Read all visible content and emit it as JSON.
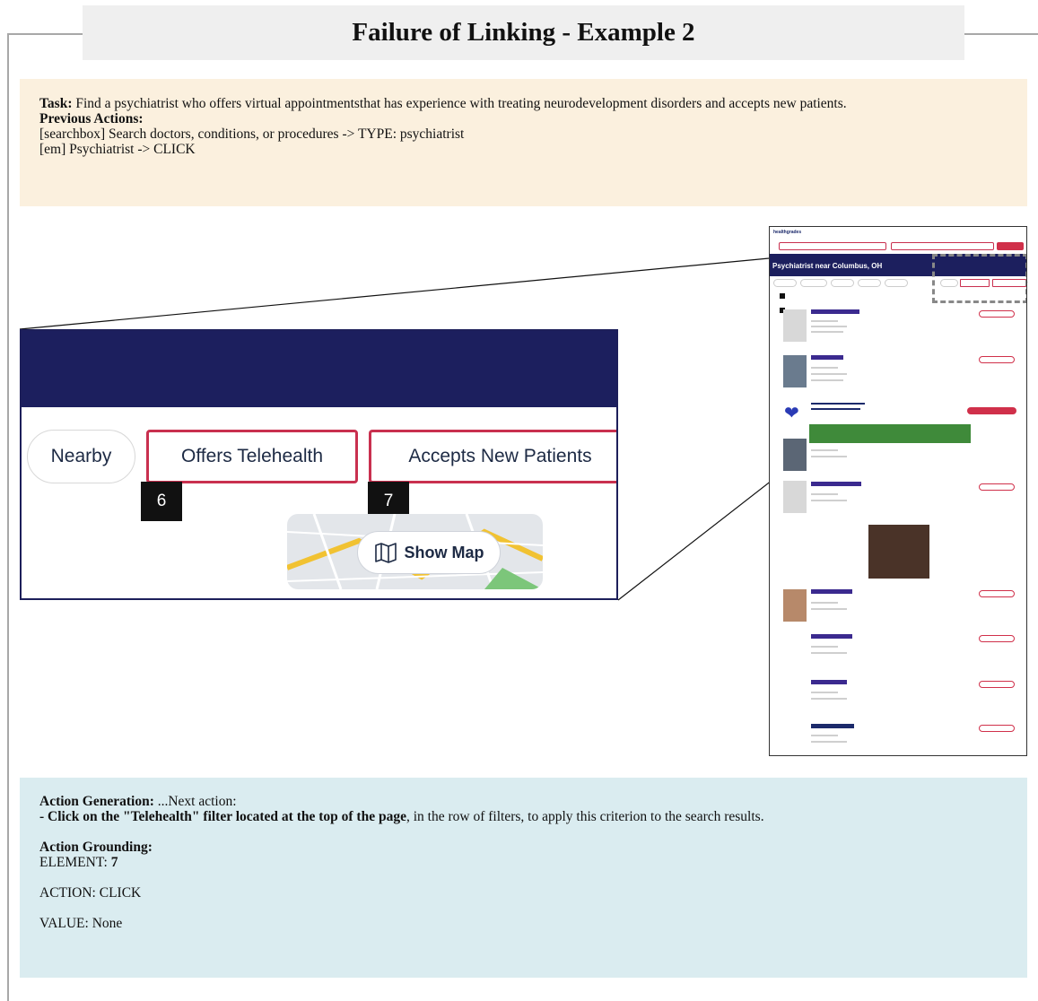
{
  "title": "Failure of Linking - Example 2",
  "task": {
    "label": "Task:",
    "text": " Find a psychiatrist who offers virtual appointmentsthat has experience with treating neurodevelopment disorders and accepts new patients.",
    "previous_label": "Previous Actions:",
    "actions": [
      "[searchbox]  Search doctors, conditions, or procedures -> TYPE: psychiatrist",
      "[em]  Psychiatrist -> CLICK"
    ]
  },
  "zoom": {
    "chips": [
      "Nearby",
      "Offers Telehealth",
      "Accepts New Patients"
    ],
    "markers": [
      "6",
      "7"
    ],
    "map_button": "Show Map"
  },
  "thumbnail": {
    "logo": "healthgrades",
    "banner": "Psychiatrist near Columbus, OH"
  },
  "action": {
    "gen_label": "Action Generation:",
    "gen_text": "  ...Next action:",
    "bold_text": "- Click on the \"Telehealth\" filter located at the top of the page",
    "rest_text": ", in the row of filters, to apply this criterion to the search results.",
    "grounding_label": "Action Grounding:",
    "element_label": "ELEMENT: ",
    "element_value": "7",
    "action_line": "ACTION: CLICK",
    "value_line": "VALUE: None"
  },
  "colors": {
    "navy": "#1c1f5e",
    "highlight_red": "#c9304f",
    "task_bg": "#fbf0de",
    "action_bg": "#daecf0"
  }
}
